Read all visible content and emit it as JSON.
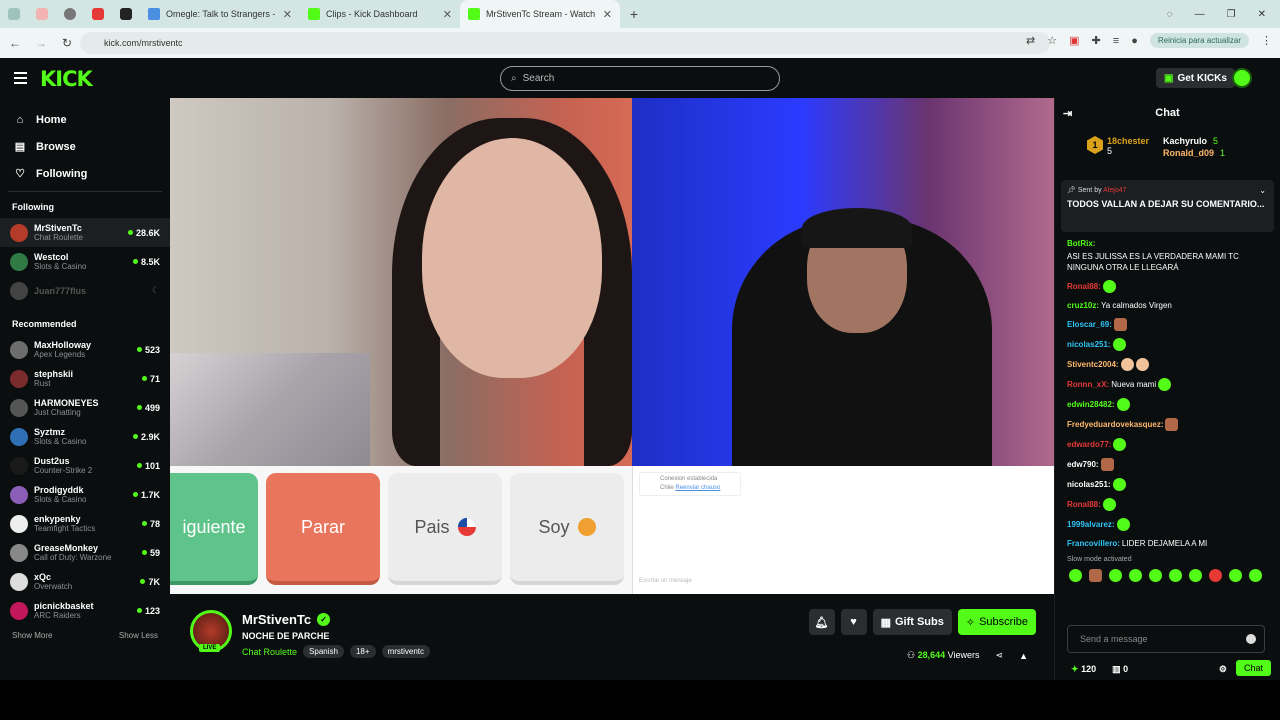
{
  "browser": {
    "tabs": [
      {
        "title": "Omegle: Talk to Strangers -",
        "color": "#4a90e2"
      },
      {
        "title": "Clips - Kick Dashboard",
        "color": "#53fc18"
      },
      {
        "title": "MrStivenTc Stream - Watch",
        "color": "#53fc18"
      }
    ],
    "url": "kick.com/mrstiventc",
    "update_label": "Reinicia para actualizar"
  },
  "header": {
    "logo": "KICK",
    "search_placeholder": "Search",
    "get_kicks": "Get KICKs"
  },
  "sidebar": {
    "nav": [
      {
        "label": "Home",
        "icon": "home-icon"
      },
      {
        "label": "Browse",
        "icon": "browse-icon"
      },
      {
        "label": "Following",
        "icon": "heart-icon"
      }
    ],
    "following_title": "Following",
    "following": [
      {
        "name": "MrStivenTc",
        "cat": "Chat Roulette",
        "viewers": "28.6K",
        "color": "#b23b2a"
      },
      {
        "name": "Westcol",
        "cat": "Slots & Casino",
        "viewers": "8.5K",
        "color": "#2f7a45"
      },
      {
        "name": "Juan777flus",
        "cat": "",
        "viewers": "",
        "color": "#444"
      }
    ],
    "recommended_title": "Recommended",
    "recommended": [
      {
        "name": "MaxHolloway",
        "cat": "Apex Legends",
        "viewers": "523",
        "color": "#6d6d6d"
      },
      {
        "name": "stephskii",
        "cat": "Rust",
        "viewers": "71",
        "color": "#7a2b2b"
      },
      {
        "name": "HARMONEYES",
        "cat": "Just Chatting",
        "viewers": "499",
        "color": "#555"
      },
      {
        "name": "Syztmz",
        "cat": "Slots & Casino",
        "viewers": "2.9K",
        "color": "#2f6fb3"
      },
      {
        "name": "Dust2us",
        "cat": "Counter-Strike 2",
        "viewers": "101",
        "color": "#1a1a1a"
      },
      {
        "name": "Prodigyddk",
        "cat": "Slots & Casino",
        "viewers": "1.7K",
        "color": "#8b5fb8"
      },
      {
        "name": "enkypenky",
        "cat": "Teamfight Tactics",
        "viewers": "78",
        "color": "#eee"
      },
      {
        "name": "GreaseMonkey",
        "cat": "Call of Duty: Warzone",
        "viewers": "59",
        "color": "#888"
      },
      {
        "name": "xQc",
        "cat": "Overwatch",
        "viewers": "7K",
        "color": "#ddd"
      },
      {
        "name": "picnickbasket",
        "cat": "ARC Raiders",
        "viewers": "123",
        "color": "#c2185b"
      }
    ],
    "show_more": "Show More",
    "show_less": "Show Less"
  },
  "player": {
    "buttons": {
      "siguiente": "iguiente",
      "parar": "Parar",
      "pais": "Pais",
      "soy": "Soy"
    },
    "omegle_msg1": "Conexion establecida",
    "omegle_msg2": "Chile",
    "omegle_msg3": "Reenviar chauso",
    "omegle_footer": "Escribe un mensaje"
  },
  "stream": {
    "name": "MrStivenTc",
    "title": "NOCHE DE PARCHE",
    "category": "Chat Roulette",
    "tags": [
      "Spanish",
      "18+",
      "mrstiventc"
    ],
    "live": "LIVE",
    "gift_subs": "Gift Subs",
    "subscribe": "Subscribe",
    "viewers": "28,644",
    "viewers_label": "Viewers"
  },
  "chat": {
    "title": "Chat",
    "leaders": [
      {
        "name": "18chester",
        "count": "5"
      },
      {
        "name": "Kachyrulo",
        "count": "5"
      },
      {
        "name": "Ronald_d09",
        "count": "1"
      }
    ],
    "pinned": {
      "sent_by": "Sent by",
      "sender": "Alejo47",
      "text": "TODOS VALLAN A DEJAR SU COMENTARIO..."
    },
    "messages": [
      {
        "user": "BotRix:",
        "color": "#53fc18",
        "text": "ASI ES JULISSA ES LA VERDADERA MAMI TC NINGUNA OTRA LE LLEGARÁ"
      },
      {
        "user": "Ronal88:",
        "color": "#e53935",
        "text": ""
      },
      {
        "user": "cruz10z:",
        "color": "#53fc18",
        "text": "Ya calmados Virgen"
      },
      {
        "user": "Eloscar_69:",
        "color": "#2ec4f5",
        "text": ""
      },
      {
        "user": "nicolas251:",
        "color": "#2ec4f5",
        "text": ""
      },
      {
        "user": "Stiventc2004:",
        "color": "#ffb86c",
        "text": ""
      },
      {
        "user": "Ronnn_xX:",
        "color": "#e53935",
        "text": "Nueva mami"
      },
      {
        "user": "edwin28482:",
        "color": "#53fc18",
        "text": ""
      },
      {
        "user": "Fredyeduardovekasquez:",
        "color": "#ffb86c",
        "text": ""
      },
      {
        "user": "edwardo77:",
        "color": "#e53935",
        "text": ""
      },
      {
        "user": "edw790:",
        "color": "#fff",
        "text": ""
      },
      {
        "user": "nicolas251:",
        "color": "#fff",
        "text": ""
      },
      {
        "user": "Ronal88:",
        "color": "#e53935",
        "text": ""
      },
      {
        "user": "1999alvarez:",
        "color": "#2ec4f5",
        "text": ""
      },
      {
        "user": "Francovillero:",
        "color": "#2ec4f5",
        "text": "LIDER DEJAMELA A MI"
      }
    ],
    "slow_mode": "Slow mode activated",
    "placeholder": "Send a message",
    "kicks": "120",
    "chat_btn": "Chat",
    "zero": "0"
  }
}
